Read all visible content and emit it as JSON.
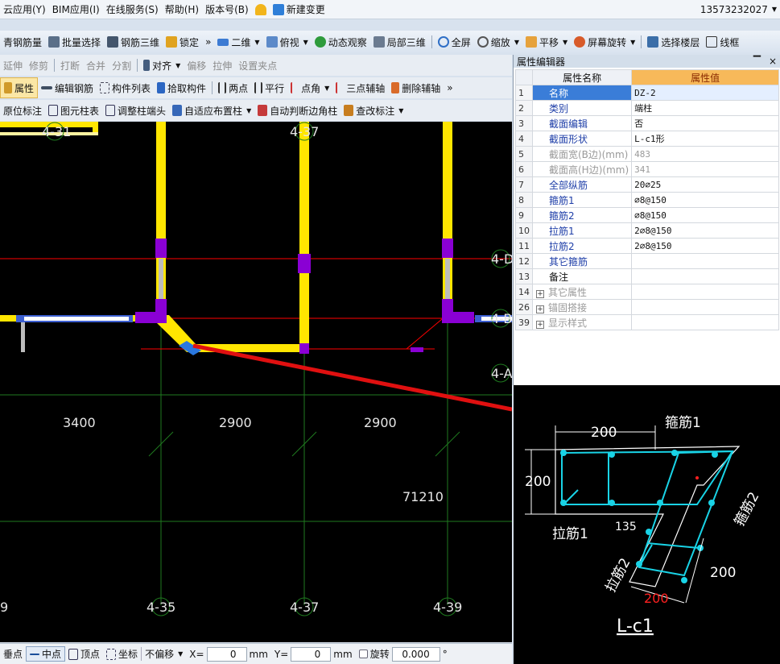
{
  "menubar": {
    "items": [
      "云应用(Y)",
      "BIM应用(I)",
      "在线服务(S)",
      "帮助(H)",
      "版本号(B)",
      "新建变更"
    ],
    "phone": "13573232027"
  },
  "toolbar1": {
    "items": [
      "青钢筋量",
      "批量选择",
      "钢筋三维",
      "锁定",
      "二维",
      "俯视",
      "动态观察",
      "局部三维",
      "全屏",
      "缩放",
      "平移",
      "屏幕旋转",
      "选择楼层",
      "线框"
    ],
    "more": "»"
  },
  "toolbar2": {
    "items": [
      "延伸",
      "修剪",
      "打断",
      "合并",
      "分割",
      "对齐",
      "偏移",
      "拉伸",
      "设置夹点"
    ]
  },
  "toolbar3": {
    "items": [
      "属性",
      "编辑钢筋",
      "构件列表",
      "拾取构件",
      "两点",
      "平行",
      "点角",
      "三点辅轴",
      "删除辅轴"
    ],
    "more": "»"
  },
  "toolbar4": {
    "items": [
      "原位标注",
      "图元柱表",
      "调整柱端头",
      "自适应布置柱",
      "自动判断边角柱",
      "查改标注"
    ]
  },
  "canvas": {
    "axis_labels": {
      "top_left": "4-31",
      "top_mid": "4-37",
      "right_d": "4-D",
      "right_mid": "4-B",
      "right_a": "4-A",
      "bottom_1": "4-35",
      "bottom_2": "4-37",
      "bottom_3": "4-39",
      "bottom_left": "9"
    },
    "dims": {
      "d1": "3400",
      "d2": "2900",
      "d3": "2900",
      "elev": "71210"
    }
  },
  "props": {
    "title": "属性编辑器",
    "pin": "ᵖ",
    "close": "×",
    "col_name": "属性名称",
    "col_value": "属性值",
    "rows": [
      {
        "n": "1",
        "name": "名称",
        "value": "DZ-2"
      },
      {
        "n": "2",
        "name": "类别",
        "value": "端柱"
      },
      {
        "n": "3",
        "name": "截面编辑",
        "value": "否"
      },
      {
        "n": "4",
        "name": "截面形状",
        "value": "L-c1形"
      },
      {
        "n": "5",
        "name": "截面宽(B边)(mm)",
        "value": "483"
      },
      {
        "n": "6",
        "name": "截面高(H边)(mm)",
        "value": "341"
      },
      {
        "n": "7",
        "name": "全部纵筋",
        "value": "20⌀25"
      },
      {
        "n": "8",
        "name": "箍筋1",
        "value": "⌀8@150"
      },
      {
        "n": "9",
        "name": "箍筋2",
        "value": "⌀8@150"
      },
      {
        "n": "10",
        "name": "拉筋1",
        "value": "2⌀8@150"
      },
      {
        "n": "11",
        "name": "拉筋2",
        "value": "2⌀8@150"
      },
      {
        "n": "12",
        "name": "其它箍筋",
        "value": ""
      },
      {
        "n": "13",
        "name": "备注",
        "value": ""
      },
      {
        "n": "14",
        "name": "其它属性",
        "value": ""
      },
      {
        "n": "26",
        "name": "锚固搭接",
        "value": ""
      },
      {
        "n": "39",
        "name": "显示样式",
        "value": ""
      }
    ]
  },
  "preview": {
    "dim_top": "200",
    "dim_left": "200",
    "dim_right": "200",
    "dim_bottom": "200",
    "angle": "135",
    "label_gujin1": "箍筋1",
    "label_gujin2": "箍筋2",
    "label_lajin1": "拉筋1",
    "label_lajin2": "拉筋2",
    "shape_name": "L-c1"
  },
  "statusbar": {
    "items": [
      "垂点",
      "中点",
      "顶点",
      "坐标",
      "不偏移"
    ],
    "x_label": "X=",
    "x_value": "0",
    "x_unit": "mm",
    "y_label": "Y=",
    "y_value": "0",
    "y_unit": "mm",
    "rotate_label": "旋转",
    "rotate_value": "0.000",
    "deg": "°"
  },
  "colors": {
    "wall": "#ffe600",
    "column": "#8a00d4",
    "axis": "#1f7a1f",
    "redline": "#ff0000",
    "rebar": "#19d3e6",
    "arrow": "#e01010"
  }
}
